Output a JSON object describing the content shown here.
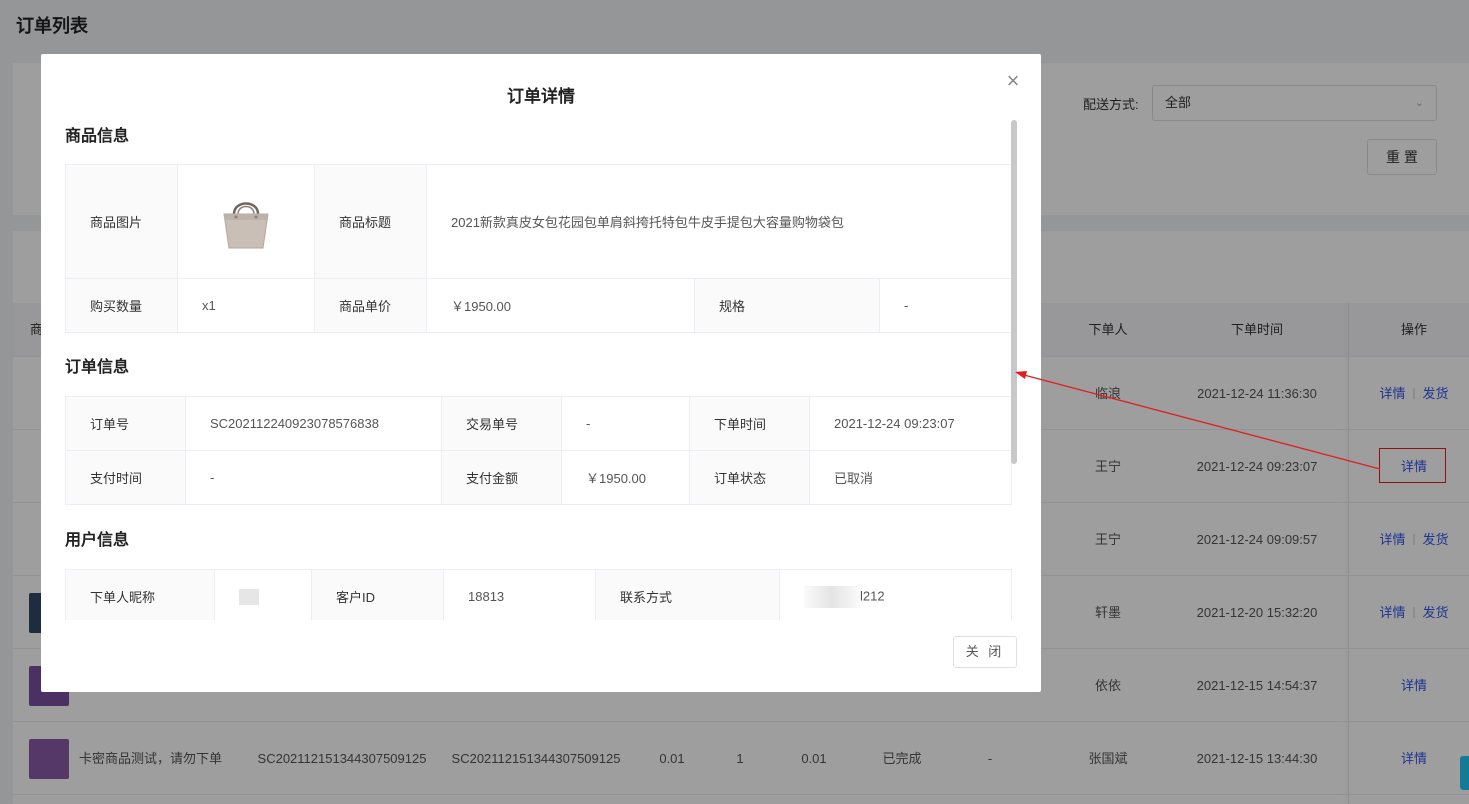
{
  "page": {
    "title": "订单列表"
  },
  "filters": {
    "delivery_label": "配送方式:",
    "delivery_value": "全部",
    "reset_label": "重 置"
  },
  "table": {
    "headers": {
      "product": "商",
      "orderer": "下单人",
      "order_time": "下单时间",
      "actions": "操作"
    },
    "rows": [
      {
        "orderer": "临浪",
        "time": "2021-12-24 11:36:30",
        "detail": "详情",
        "ship": "发货"
      },
      {
        "orderer": "王宁",
        "time": "2021-12-24 09:23:07",
        "detail": "详情",
        "ship": ""
      },
      {
        "orderer": "王宁",
        "time": "2021-12-24 09:09:57",
        "detail": "详情",
        "ship": "发货"
      },
      {
        "orderer": "轩墨",
        "time": "2021-12-20 15:32:20",
        "detail": "详情",
        "ship": "发货"
      },
      {
        "orderer": "依依",
        "time": "2021-12-15 14:54:37",
        "detail": "详情",
        "ship": ""
      },
      {
        "product_name": "卡密商品测试，请勿下单",
        "order_no": "SC202112151344307509125",
        "trade_no": "SC202112151344307509125",
        "price": "0.01",
        "qty": "1",
        "amount": "0.01",
        "status": "已完成",
        "delivery": "-",
        "orderer": "张国斌",
        "time": "2021-12-15 13:44:30",
        "detail": "详情",
        "ship": ""
      }
    ]
  },
  "modal": {
    "title": "订单详情",
    "close_icon": "×",
    "close_button": "关 闭",
    "product_section": {
      "title": "商品信息",
      "image_label": "商品图片",
      "title_label": "商品标题",
      "title_value": "2021新款真皮女包花园包单肩斜挎托特包牛皮手提包大容量购物袋包",
      "qty_label": "购买数量",
      "qty_value": "x1",
      "price_label": "商品单价",
      "price_value": "￥1950.00",
      "spec_label": "规格",
      "spec_value": "-"
    },
    "order_section": {
      "title": "订单信息",
      "order_no_label": "订单号",
      "order_no_value": "SC202112240923078576838",
      "trade_no_label": "交易单号",
      "trade_no_value": "-",
      "order_time_label": "下单时间",
      "order_time_value": "2021-12-24 09:23:07",
      "pay_time_label": "支付时间",
      "pay_time_value": "-",
      "pay_amount_label": "支付金额",
      "pay_amount_value": "￥1950.00",
      "status_label": "订单状态",
      "status_value": "已取消"
    },
    "user_section": {
      "title": "用户信息",
      "nickname_label": "下单人昵称",
      "customer_id_label": "客户ID",
      "customer_id_value": "18813",
      "contact_label": "联系方式",
      "contact_value_suffix": "l212"
    }
  },
  "colors": {
    "link": "#2f54eb",
    "annotation": "#e02020",
    "side_tab": "#23c6f2"
  }
}
